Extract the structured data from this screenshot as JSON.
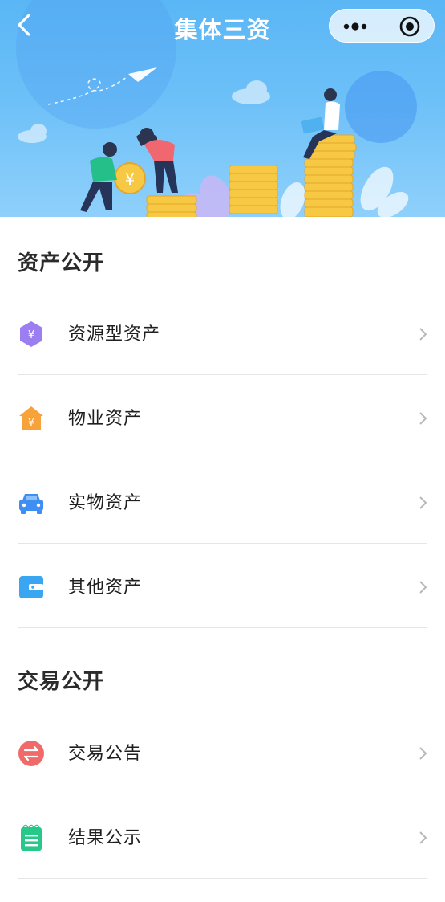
{
  "nav": {
    "title": "集体三资",
    "back_icon": "chevron-left-icon",
    "more_icon": "more-dots-icon",
    "close_icon": "target-circle-icon"
  },
  "hero": {
    "illustration": "people-stacking-gold-coins",
    "colors": {
      "sky_top": "#5ab6f5",
      "sky_bottom": "#8fd0fb",
      "coin": "#f7c843"
    }
  },
  "sections": [
    {
      "title": "资产公开",
      "items": [
        {
          "label": "资源型资产",
          "icon": "purple-hexagon-yuan-icon",
          "color": "#9b7ff0"
        },
        {
          "label": "物业资产",
          "icon": "orange-house-yuan-icon",
          "color": "#f7a23a"
        },
        {
          "label": "实物资产",
          "icon": "blue-car-icon",
          "color": "#3f8ef3"
        },
        {
          "label": "其他资产",
          "icon": "blue-wallet-icon",
          "color": "#3aa6f2"
        }
      ]
    },
    {
      "title": "交易公开",
      "items": [
        {
          "label": "交易公告",
          "icon": "red-exchange-icon",
          "color": "#f06a6a"
        },
        {
          "label": "结果公示",
          "icon": "green-notepad-icon",
          "color": "#27c88a"
        }
      ]
    }
  ],
  "chevron_icon": "chevron-right-icon"
}
